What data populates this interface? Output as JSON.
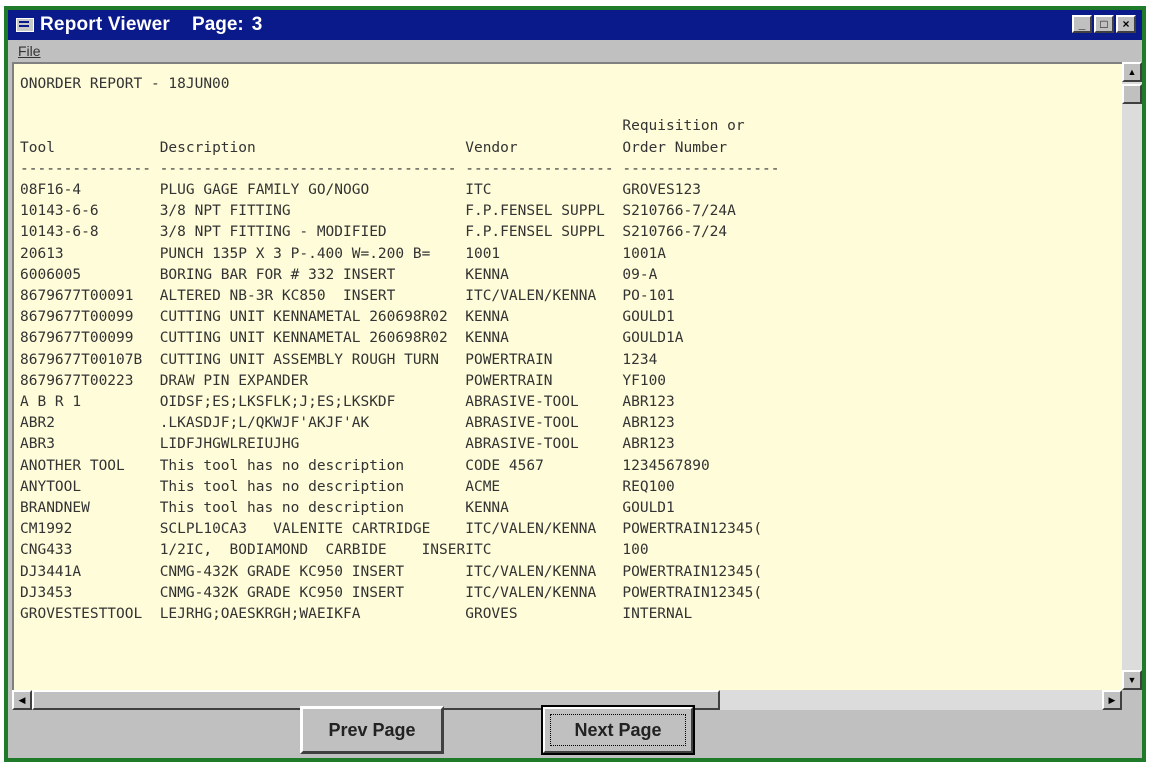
{
  "window": {
    "title": "Report Viewer",
    "page_label": "Page:",
    "page_number": "3",
    "controls": [
      "_",
      "□",
      "×"
    ]
  },
  "menu": {
    "file": "File"
  },
  "report": {
    "heading": "ONORDER REPORT - 18JUN00",
    "columns": [
      "Tool",
      "Description",
      "Vendor",
      "Requisition or Order Number"
    ],
    "rows": [
      [
        "08F16-4",
        "PLUG GAGE FAMILY GO/NOGO",
        "ITC",
        "GROVES123"
      ],
      [
        "10143-6-6",
        "3/8 NPT FITTING",
        "F.P.FENSEL SUPPL",
        "S210766-7/24A"
      ],
      [
        "10143-6-8",
        "3/8 NPT FITTING - MODIFIED",
        "F.P.FENSEL SUPPL",
        "S210766-7/24"
      ],
      [
        "20613",
        "PUNCH 135P X 3 P-.400 W=.200 B=",
        "1001",
        "1001A"
      ],
      [
        "6006005",
        "BORING BAR FOR # 332 INSERT",
        "KENNA",
        "09-A"
      ],
      [
        "8679677T00091",
        "ALTERED NB-3R KC850  INSERT",
        "ITC/VALEN/KENNA",
        "PO-101"
      ],
      [
        "8679677T00099",
        "CUTTING UNIT KENNAMETAL 260698R02",
        "KENNA",
        "GOULD1"
      ],
      [
        "8679677T00099",
        "CUTTING UNIT KENNAMETAL 260698R02",
        "KENNA",
        "GOULD1A"
      ],
      [
        "8679677T00107B",
        "CUTTING UNIT ASSEMBLY ROUGH TURN",
        "POWERTRAIN",
        "1234"
      ],
      [
        "8679677T00223",
        "DRAW PIN EXPANDER",
        "POWERTRAIN",
        "YF100"
      ],
      [
        "A B R 1",
        "OIDSF;ES;LKSFLK;J;ES;LKSKDF",
        "ABRASIVE-TOOL",
        "ABR123"
      ],
      [
        "ABR2",
        ".LKASDJF;L/QKWJF'AKJF'AK",
        "ABRASIVE-TOOL",
        "ABR123"
      ],
      [
        "ABR3",
        "LIDFJHGWLREIUJHG",
        "ABRASIVE-TOOL",
        "ABR123"
      ],
      [
        "ANOTHER TOOL",
        "This tool has no description",
        "CODE 4567",
        "1234567890"
      ],
      [
        "ANYTOOL",
        "This tool has no description",
        "ACME",
        "REQ100"
      ],
      [
        "BRANDNEW",
        "This tool has no description",
        "KENNA",
        "GOULD1"
      ],
      [
        "CM1992",
        "SCLPL10CA3   VALENITE CARTRIDGE",
        "ITC/VALEN/KENNA",
        "POWERTRAIN12345("
      ],
      [
        "CNG433",
        "1/2IC,  BODIAMOND  CARBIDE    INSERT",
        "ITC",
        "100"
      ],
      [
        "DJ3441A",
        "CNMG-432K GRADE KC950 INSERT",
        "ITC/VALEN/KENNA",
        "POWERTRAIN12345("
      ],
      [
        "DJ3453",
        "CNMG-432K GRADE KC950 INSERT",
        "ITC/VALEN/KENNA",
        "POWERTRAIN12345("
      ],
      [
        "GROVESTESTTOOL",
        "LEJRHG;OAESKRGH;WAEIKFA",
        "GROVES",
        "INTERNAL"
      ]
    ]
  },
  "buttons": {
    "prev": "Prev Page",
    "next": "Next Page"
  }
}
